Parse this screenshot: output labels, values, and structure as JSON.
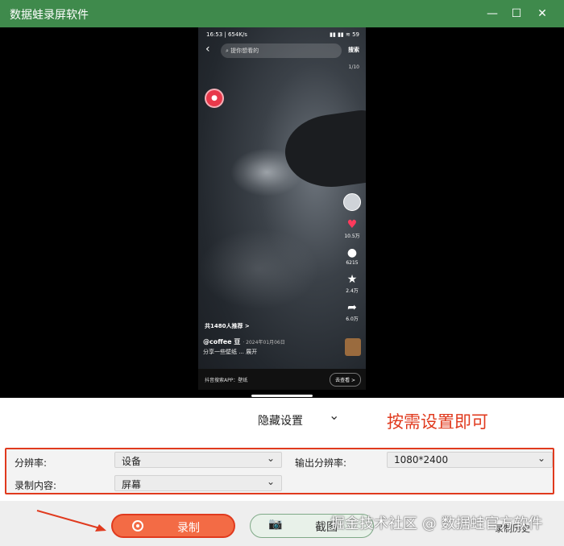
{
  "window": {
    "title": "数据蛙录屏软件",
    "controls": {
      "minimize": "—",
      "maximize": "☐",
      "close": "✕"
    }
  },
  "phone": {
    "status_time": "16:53 | 654K/s",
    "status_right": "▮▮ ▮▮ ≋ 59",
    "search_placeholder": "提你想看的",
    "search_button": "搜索",
    "counter": "1/10",
    "red_badge": "●",
    "likes": "10.5万",
    "comments": "6215",
    "favorites": "2.4万",
    "shares": "6.0万",
    "recommend": "共1480人推荐 >",
    "author": "@coffee 豆",
    "post_date": "· 2024年01月06日",
    "description": "分享一些壁纸 ... 展开",
    "bottom_search": "抖音搜索APP：壁纸",
    "go_watch": "去查看 >"
  },
  "hidden_settings": {
    "label": "隐藏设置"
  },
  "annotation": "按需设置即可",
  "settings": {
    "resolution_label": "分辨率:",
    "resolution_value": "设备",
    "output_resolution_label": "输出分辨率:",
    "output_resolution_value": "1080*2400",
    "record_content_label": "录制内容:",
    "record_content_value": "屏幕"
  },
  "footer": {
    "record_label": "录制",
    "screenshot_label": "截图",
    "history_label": "录制历史"
  },
  "watermark": "掘金技术社区 @ 数据蛙官方软件",
  "colors": {
    "titlebar": "#3f8a4c",
    "accent": "#f36b45",
    "annotation": "#e03a1e"
  }
}
